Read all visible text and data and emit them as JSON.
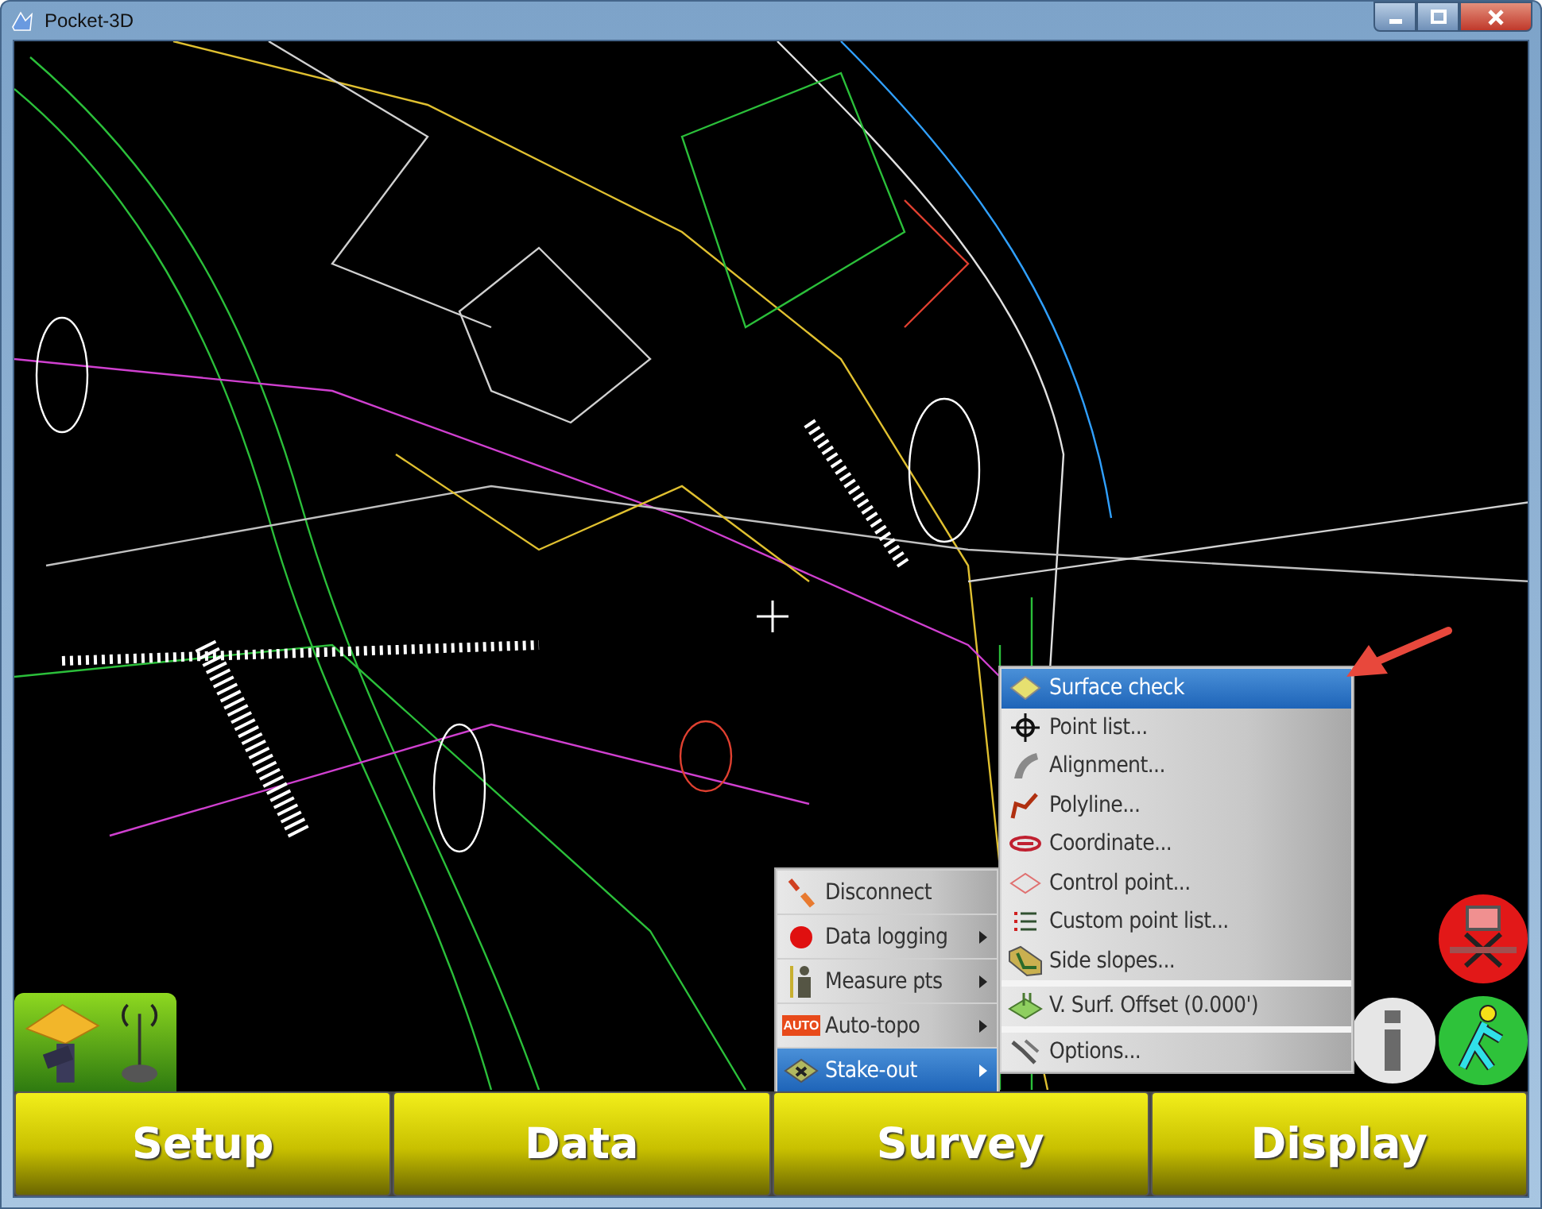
{
  "window": {
    "title": "Pocket-3D"
  },
  "menu": {
    "items": [
      {
        "label": "Disconnect",
        "has_submenu": false,
        "selected": false
      },
      {
        "label": "Data logging",
        "has_submenu": true,
        "selected": false
      },
      {
        "label": "Measure pts",
        "has_submenu": true,
        "selected": false
      },
      {
        "label": "Auto-topo",
        "has_submenu": true,
        "selected": false,
        "icon_text": "AUTO"
      },
      {
        "label": "Stake-out",
        "has_submenu": true,
        "selected": true
      }
    ]
  },
  "submenu": {
    "items": [
      {
        "label": "Surface check",
        "selected": true,
        "separator_before": false
      },
      {
        "label": "Point list...",
        "selected": false,
        "separator_before": false
      },
      {
        "label": "Alignment...",
        "selected": false,
        "separator_before": false
      },
      {
        "label": "Polyline...",
        "selected": false,
        "separator_before": false
      },
      {
        "label": "Coordinate...",
        "selected": false,
        "separator_before": false
      },
      {
        "label": "Control point...",
        "selected": false,
        "separator_before": false
      },
      {
        "label": "Custom point list...",
        "selected": false,
        "separator_before": false
      },
      {
        "label": "Side slopes...",
        "selected": false,
        "separator_before": false
      },
      {
        "label": "V. Surf. Offset (0.000')",
        "selected": false,
        "separator_before": true
      },
      {
        "label": "Options...",
        "selected": false,
        "separator_before": true
      }
    ]
  },
  "bottom_buttons": [
    "Setup",
    "Data",
    "Survey",
    "Display"
  ]
}
